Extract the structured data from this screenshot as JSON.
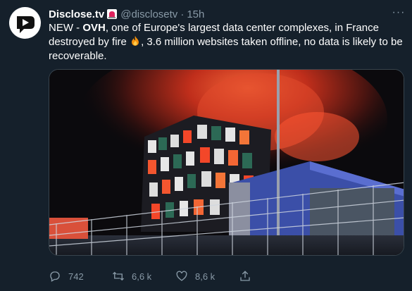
{
  "account": {
    "display_name": "Disclose.tv",
    "handle": "@disclosetv",
    "time": "15h",
    "separator": "·"
  },
  "tweet": {
    "prefix": "NEW - ",
    "highlight": "OVH",
    "text_1": ", one of Europe's largest data center complexes, in France destroyed by fire ",
    "text_2": ", 3.6 million websites taken offline, no data is likely to be recoverable."
  },
  "icons": {
    "avatar": "disclose-logo-icon",
    "badge": "siren-icon",
    "emoji": "fire-emoji-icon",
    "more": "more-icon",
    "reply": "reply-icon",
    "retweet": "retweet-icon",
    "like": "heart-icon",
    "share": "share-icon"
  },
  "stats": {
    "replies": "742",
    "retweets": "6,6 k",
    "likes": "8,6 k"
  },
  "colors": {
    "background": "#15202b",
    "secondary_text": "#8899a6",
    "fire": "#ff3b1f"
  }
}
